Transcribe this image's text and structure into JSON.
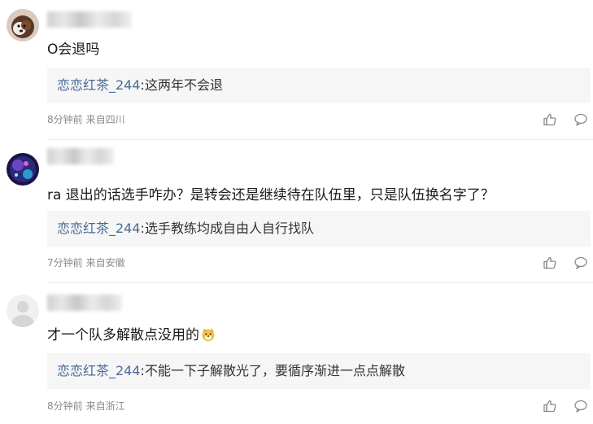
{
  "comments": [
    {
      "text": "O会退吗",
      "reply": {
        "user": "恋恋红茶_244",
        "sep": ":",
        "text": "这两年不会退"
      },
      "time": "8分钟前",
      "location": "来自四川",
      "avatar": "dog-avatar"
    },
    {
      "text": "ra 退出的话选手咋办？是转会还是继续待在队伍里，只是队伍换名字了？",
      "reply": {
        "user": "恋恋红茶_244",
        "sep": ":",
        "text": "选手教练均成自由人自行找队"
      },
      "time": "7分钟前",
      "location": "来自安徽",
      "avatar": "galaxy-avatar"
    },
    {
      "text": "才一个队多解散点没用的",
      "emoji": "doge-emoji",
      "reply": {
        "user": "恋恋红茶_244",
        "sep": ":",
        "text": "不能一下子解散光了，要循序渐进一点点解散"
      },
      "time": "8分钟前",
      "location": "来自浙江",
      "avatar": "default-avatar"
    }
  ],
  "colors": {
    "reply_user": "#4a6b95",
    "meta": "#8a8a8a",
    "reply_bg": "#f6f6f6",
    "divider": "#ebebeb"
  },
  "icons": {
    "like": "thumbs-up-icon",
    "reply": "comment-bubble-icon"
  }
}
